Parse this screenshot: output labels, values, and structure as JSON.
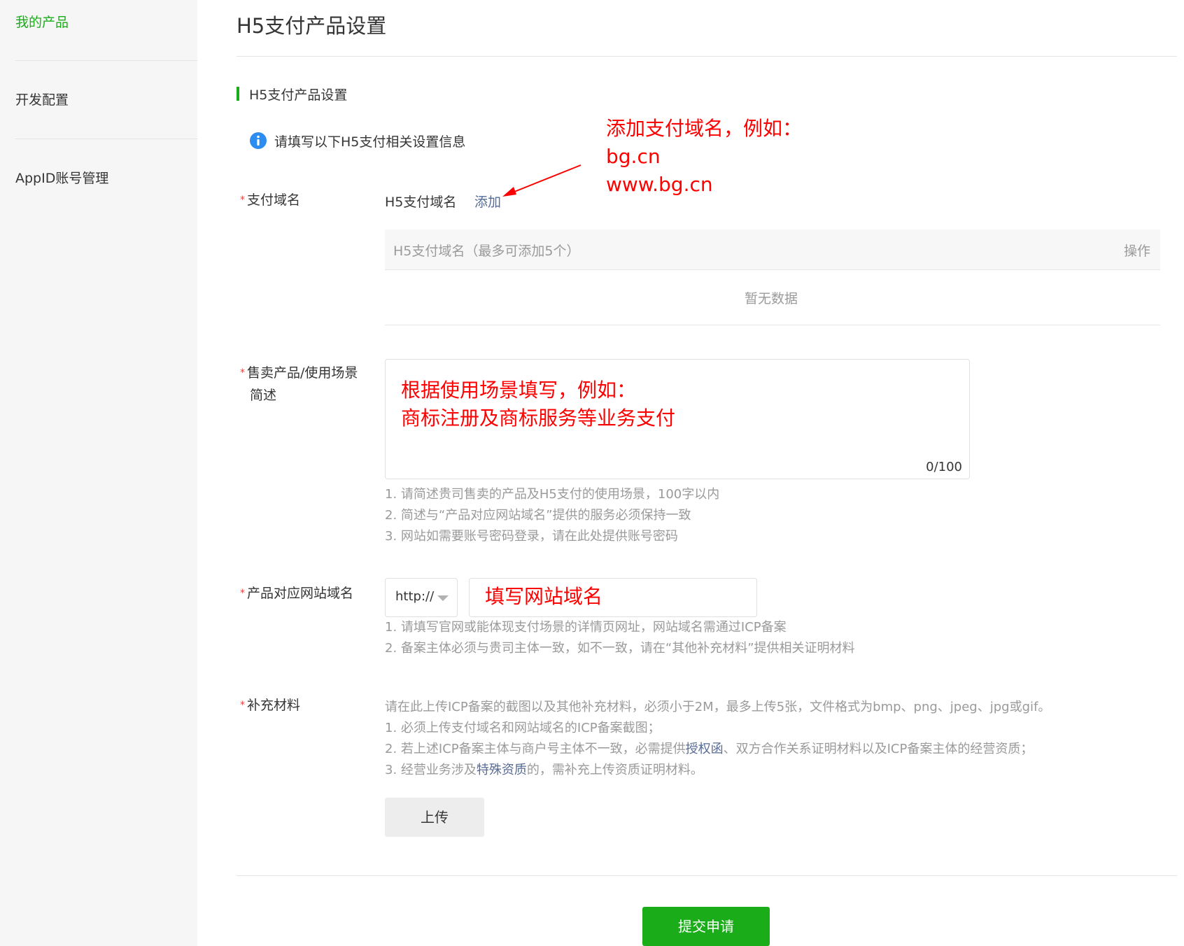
{
  "sidebar": {
    "items": [
      {
        "label": "我的产品",
        "active": true
      },
      {
        "label": "开发配置",
        "active": false
      },
      {
        "label": "AppID账号管理",
        "active": false
      }
    ]
  },
  "header": {
    "title": "H5支付产品设置"
  },
  "section": {
    "title": "H5支付产品设置",
    "info_text": "请填写以下H5支付相关设置信息"
  },
  "domain": {
    "label": "支付域名",
    "inline_label": "H5支付域名",
    "add_label": "添加",
    "table_header_domain": "H5支付域名（最多可添加5个）",
    "table_header_op": "操作",
    "empty_text": "暂无数据"
  },
  "description": {
    "label_line1": "售卖产品/使用场景",
    "label_line2": "简述",
    "counter": "0/100",
    "hints": [
      "1. 请简述贵司售卖的产品及H5支付的使用场景，100字以内",
      "2. 简述与“产品对应网站域名”提供的服务必须保持一致",
      "3. 网站如需要账号密码登录，请在此处提供账号密码"
    ]
  },
  "website": {
    "label": "产品对应网站域名",
    "protocol": "http://",
    "hints": [
      "1. 请填写官网或能体现支付场景的详情页网址，网站域名需通过ICP备案",
      "2. 备案主体必须与贵司主体一致，如不一致，请在“其他补充材料”提供相关证明材料"
    ]
  },
  "materials": {
    "label": "补充材料",
    "line0": "请在此上传ICP备案的截图以及其他补充材料，必须小于2M，最多上传5张，文件格式为bmp、png、jpeg、jpg或gif。",
    "line1": "1. 必须上传支付域名和网站域名的ICP备案截图；",
    "line2_a": "2. 若上述ICP备案主体与商户号主体不一致，必需提供",
    "line2_link": "授权函",
    "line2_b": "、双方合作关系证明材料以及ICP备案主体的经营资质；",
    "line3_a": "3. 经营业务涉及",
    "line3_link": "特殊资质",
    "line3_b": "的，需补充上传资质证明材料。",
    "upload_label": "上传"
  },
  "submit_label": "提交申请",
  "annotations": {
    "domain_example": [
      "添加支付域名，例如：",
      "bg.cn",
      "www.bg.cn"
    ],
    "description_example": [
      "根据使用场景填写，例如：",
      "商标注册及商标服务等业务支付"
    ],
    "website_example": "填写网站域名"
  },
  "colors": {
    "brand_green": "#1aad19",
    "link_blue": "#576b95",
    "annotation_red": "#ff0000",
    "required_star": "#e64340",
    "info_blue": "#2d8cf0"
  }
}
